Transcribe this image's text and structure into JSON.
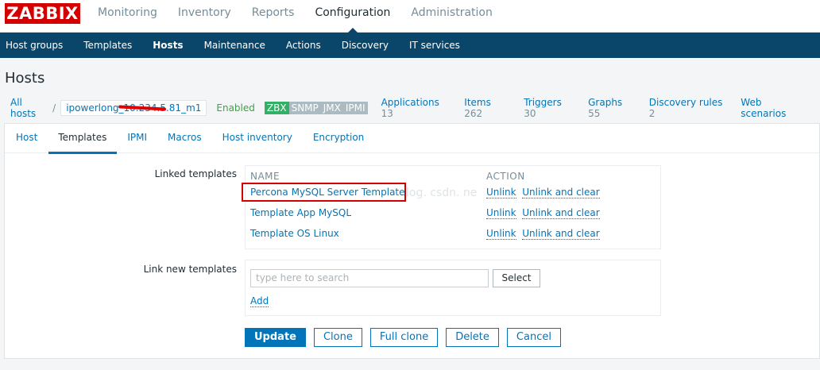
{
  "logo": "ZABBIX",
  "main_menu": [
    "Monitoring",
    "Inventory",
    "Reports",
    "Configuration",
    "Administration"
  ],
  "main_menu_active": "Configuration",
  "sub_menu": [
    "Host groups",
    "Templates",
    "Hosts",
    "Maintenance",
    "Actions",
    "Discovery",
    "IT services"
  ],
  "sub_menu_active": "Hosts",
  "page_title": "Hosts",
  "host_nav": {
    "all_hosts": "All hosts",
    "separator": "/",
    "host_name": "ipowerlong_10.234.5.81_m1",
    "status": "Enabled",
    "badges": [
      {
        "label": "ZBX",
        "color": "#34af67"
      },
      {
        "label": "SNMP",
        "color": "#acbbc2"
      },
      {
        "label": "JMX",
        "color": "#acbbc2"
      },
      {
        "label": "IPMI",
        "color": "#acbbc2"
      }
    ],
    "items": [
      {
        "label": "Applications",
        "count": "13"
      },
      {
        "label": "Items",
        "count": "262"
      },
      {
        "label": "Triggers",
        "count": "30"
      },
      {
        "label": "Graphs",
        "count": "55"
      },
      {
        "label": "Discovery rules",
        "count": "2"
      },
      {
        "label": "Web scenarios",
        "count": ""
      }
    ]
  },
  "tabs": [
    "Host",
    "Templates",
    "IPMI",
    "Macros",
    "Host inventory",
    "Encryption"
  ],
  "tabs_active": "Templates",
  "linked_templates": {
    "label": "Linked templates",
    "col_name": "NAME",
    "col_action": "ACTION",
    "rows": [
      {
        "name": "Percona MySQL Server Template",
        "unlink": "Unlink",
        "unlink_clear": "Unlink and clear"
      },
      {
        "name": "Template App MySQL",
        "unlink": "Unlink",
        "unlink_clear": "Unlink and clear"
      },
      {
        "name": "Template OS Linux",
        "unlink": "Unlink",
        "unlink_clear": "Unlink and clear"
      }
    ]
  },
  "watermark": "log. csdn. ne",
  "link_new": {
    "label": "Link new templates",
    "placeholder": "type here to search",
    "select_label": "Select",
    "add_label": "Add"
  },
  "buttons": {
    "update": "Update",
    "clone": "Clone",
    "full_clone": "Full clone",
    "delete": "Delete",
    "cancel": "Cancel"
  },
  "colors": {
    "brand_red": "#d40000",
    "nav_blue": "#0a466a",
    "link_blue": "#0275b8",
    "enabled_green": "#429e47"
  }
}
